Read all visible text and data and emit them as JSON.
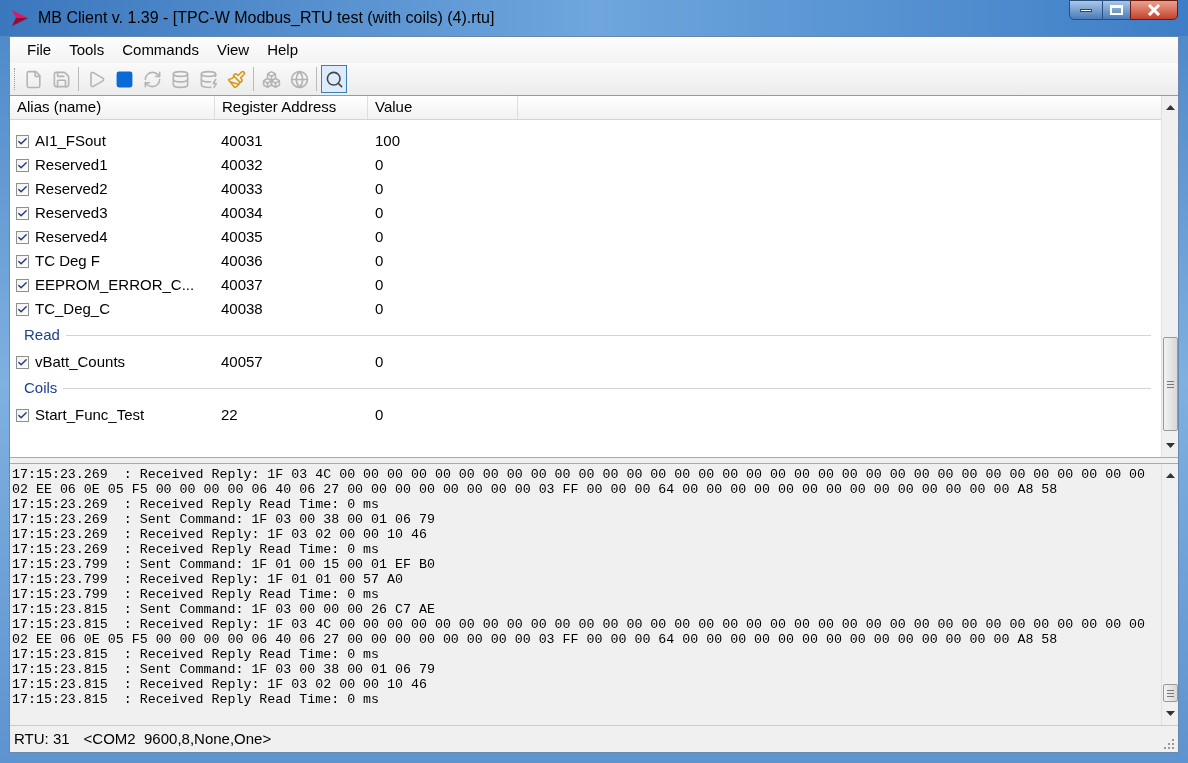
{
  "window": {
    "title": "MB Client v. 1.39 - [TPC-W Modbus_RTU test (with coils) (4).rtu]"
  },
  "menu": [
    "File",
    "Tools",
    "Commands",
    "View",
    "Help"
  ],
  "toolbar": [
    {
      "disabled": true,
      "selected": false
    },
    {
      "disabled": true,
      "selected": false
    },
    {
      "disabled": true,
      "selected": false
    },
    {
      "disabled": false,
      "selected": false
    },
    {
      "disabled": true,
      "selected": false
    },
    {
      "disabled": true,
      "selected": false
    },
    {
      "disabled": true,
      "selected": false
    },
    {
      "disabled": false,
      "selected": false
    },
    {
      "disabled": true,
      "selected": false
    },
    {
      "disabled": true,
      "selected": false
    },
    {
      "disabled": false,
      "selected": true
    }
  ],
  "table": {
    "columns": [
      "Alias (name)",
      "Register Address",
      "Value"
    ],
    "rows": [
      {
        "kind": "register",
        "checked": true,
        "alias": "AI1_FSout",
        "address": "40031",
        "value": "100"
      },
      {
        "kind": "register",
        "checked": true,
        "alias": "Reserved1",
        "address": "40032",
        "value": "0"
      },
      {
        "kind": "register",
        "checked": true,
        "alias": "Reserved2",
        "address": "40033",
        "value": "0"
      },
      {
        "kind": "register",
        "checked": true,
        "alias": "Reserved3",
        "address": "40034",
        "value": "0"
      },
      {
        "kind": "register",
        "checked": true,
        "alias": "Reserved4",
        "address": "40035",
        "value": "0"
      },
      {
        "kind": "register",
        "checked": true,
        "alias": "TC Deg F",
        "address": "40036",
        "value": "0"
      },
      {
        "kind": "register",
        "checked": true,
        "alias": "EEPROM_ERROR_C...",
        "address": "40037",
        "value": "0"
      },
      {
        "kind": "register",
        "checked": true,
        "alias": "TC_Deg_C",
        "address": "40038",
        "value": "0"
      },
      {
        "kind": "group",
        "label": "Read"
      },
      {
        "kind": "register",
        "checked": true,
        "alias": "vBatt_Counts",
        "address": "40057",
        "value": "0"
      },
      {
        "kind": "group",
        "label": "Coils"
      },
      {
        "kind": "register",
        "checked": true,
        "alias": "Start_Func_Test",
        "address": "22",
        "value": "0"
      }
    ]
  },
  "log": [
    "17:15:23.269  : Received Reply: 1F 03 4C 00 00 00 00 00 00 00 00 00 00 00 00 00 00 00 00 00 00 00 00 00 00 00 00 00 00 00 00 00 00 00 00 00 00",
    "02 EE 06 0E 05 F5 00 00 00 00 06 40 06 27 00 00 00 00 00 00 00 00 03 FF 00 00 00 64 00 00 00 00 00 00 00 00 00 00 00 00 00 00 A8 58",
    "17:15:23.269  : Received Reply Read Time: 0 ms",
    "17:15:23.269  : Sent Command: 1F 03 00 38 00 01 06 79",
    "17:15:23.269  : Received Reply: 1F 03 02 00 00 10 46",
    "17:15:23.269  : Received Reply Read Time: 0 ms",
    "17:15:23.799  : Sent Command: 1F 01 00 15 00 01 EF B0",
    "17:15:23.799  : Received Reply: 1F 01 01 00 57 A0",
    "17:15:23.799  : Received Reply Read Time: 0 ms",
    "17:15:23.815  : Sent Command: 1F 03 00 00 00 26 C7 AE",
    "17:15:23.815  : Received Reply: 1F 03 4C 00 00 00 00 00 00 00 00 00 00 00 00 00 00 00 00 00 00 00 00 00 00 00 00 00 00 00 00 00 00 00 00 00 00",
    "02 EE 06 0E 05 F5 00 00 00 00 06 40 06 27 00 00 00 00 00 00 00 00 03 FF 00 00 00 64 00 00 00 00 00 00 00 00 00 00 00 00 00 00 A8 58",
    "17:15:23.815  : Received Reply Read Time: 0 ms",
    "17:15:23.815  : Sent Command: 1F 03 00 38 00 01 06 79",
    "17:15:23.815  : Received Reply: 1F 03 02 00 00 10 46",
    "17:15:23.815  : Received Reply Read Time: 0 ms"
  ],
  "status_bar": [
    "RTU: 31",
    "<COM2  9600,8,None,One>"
  ]
}
